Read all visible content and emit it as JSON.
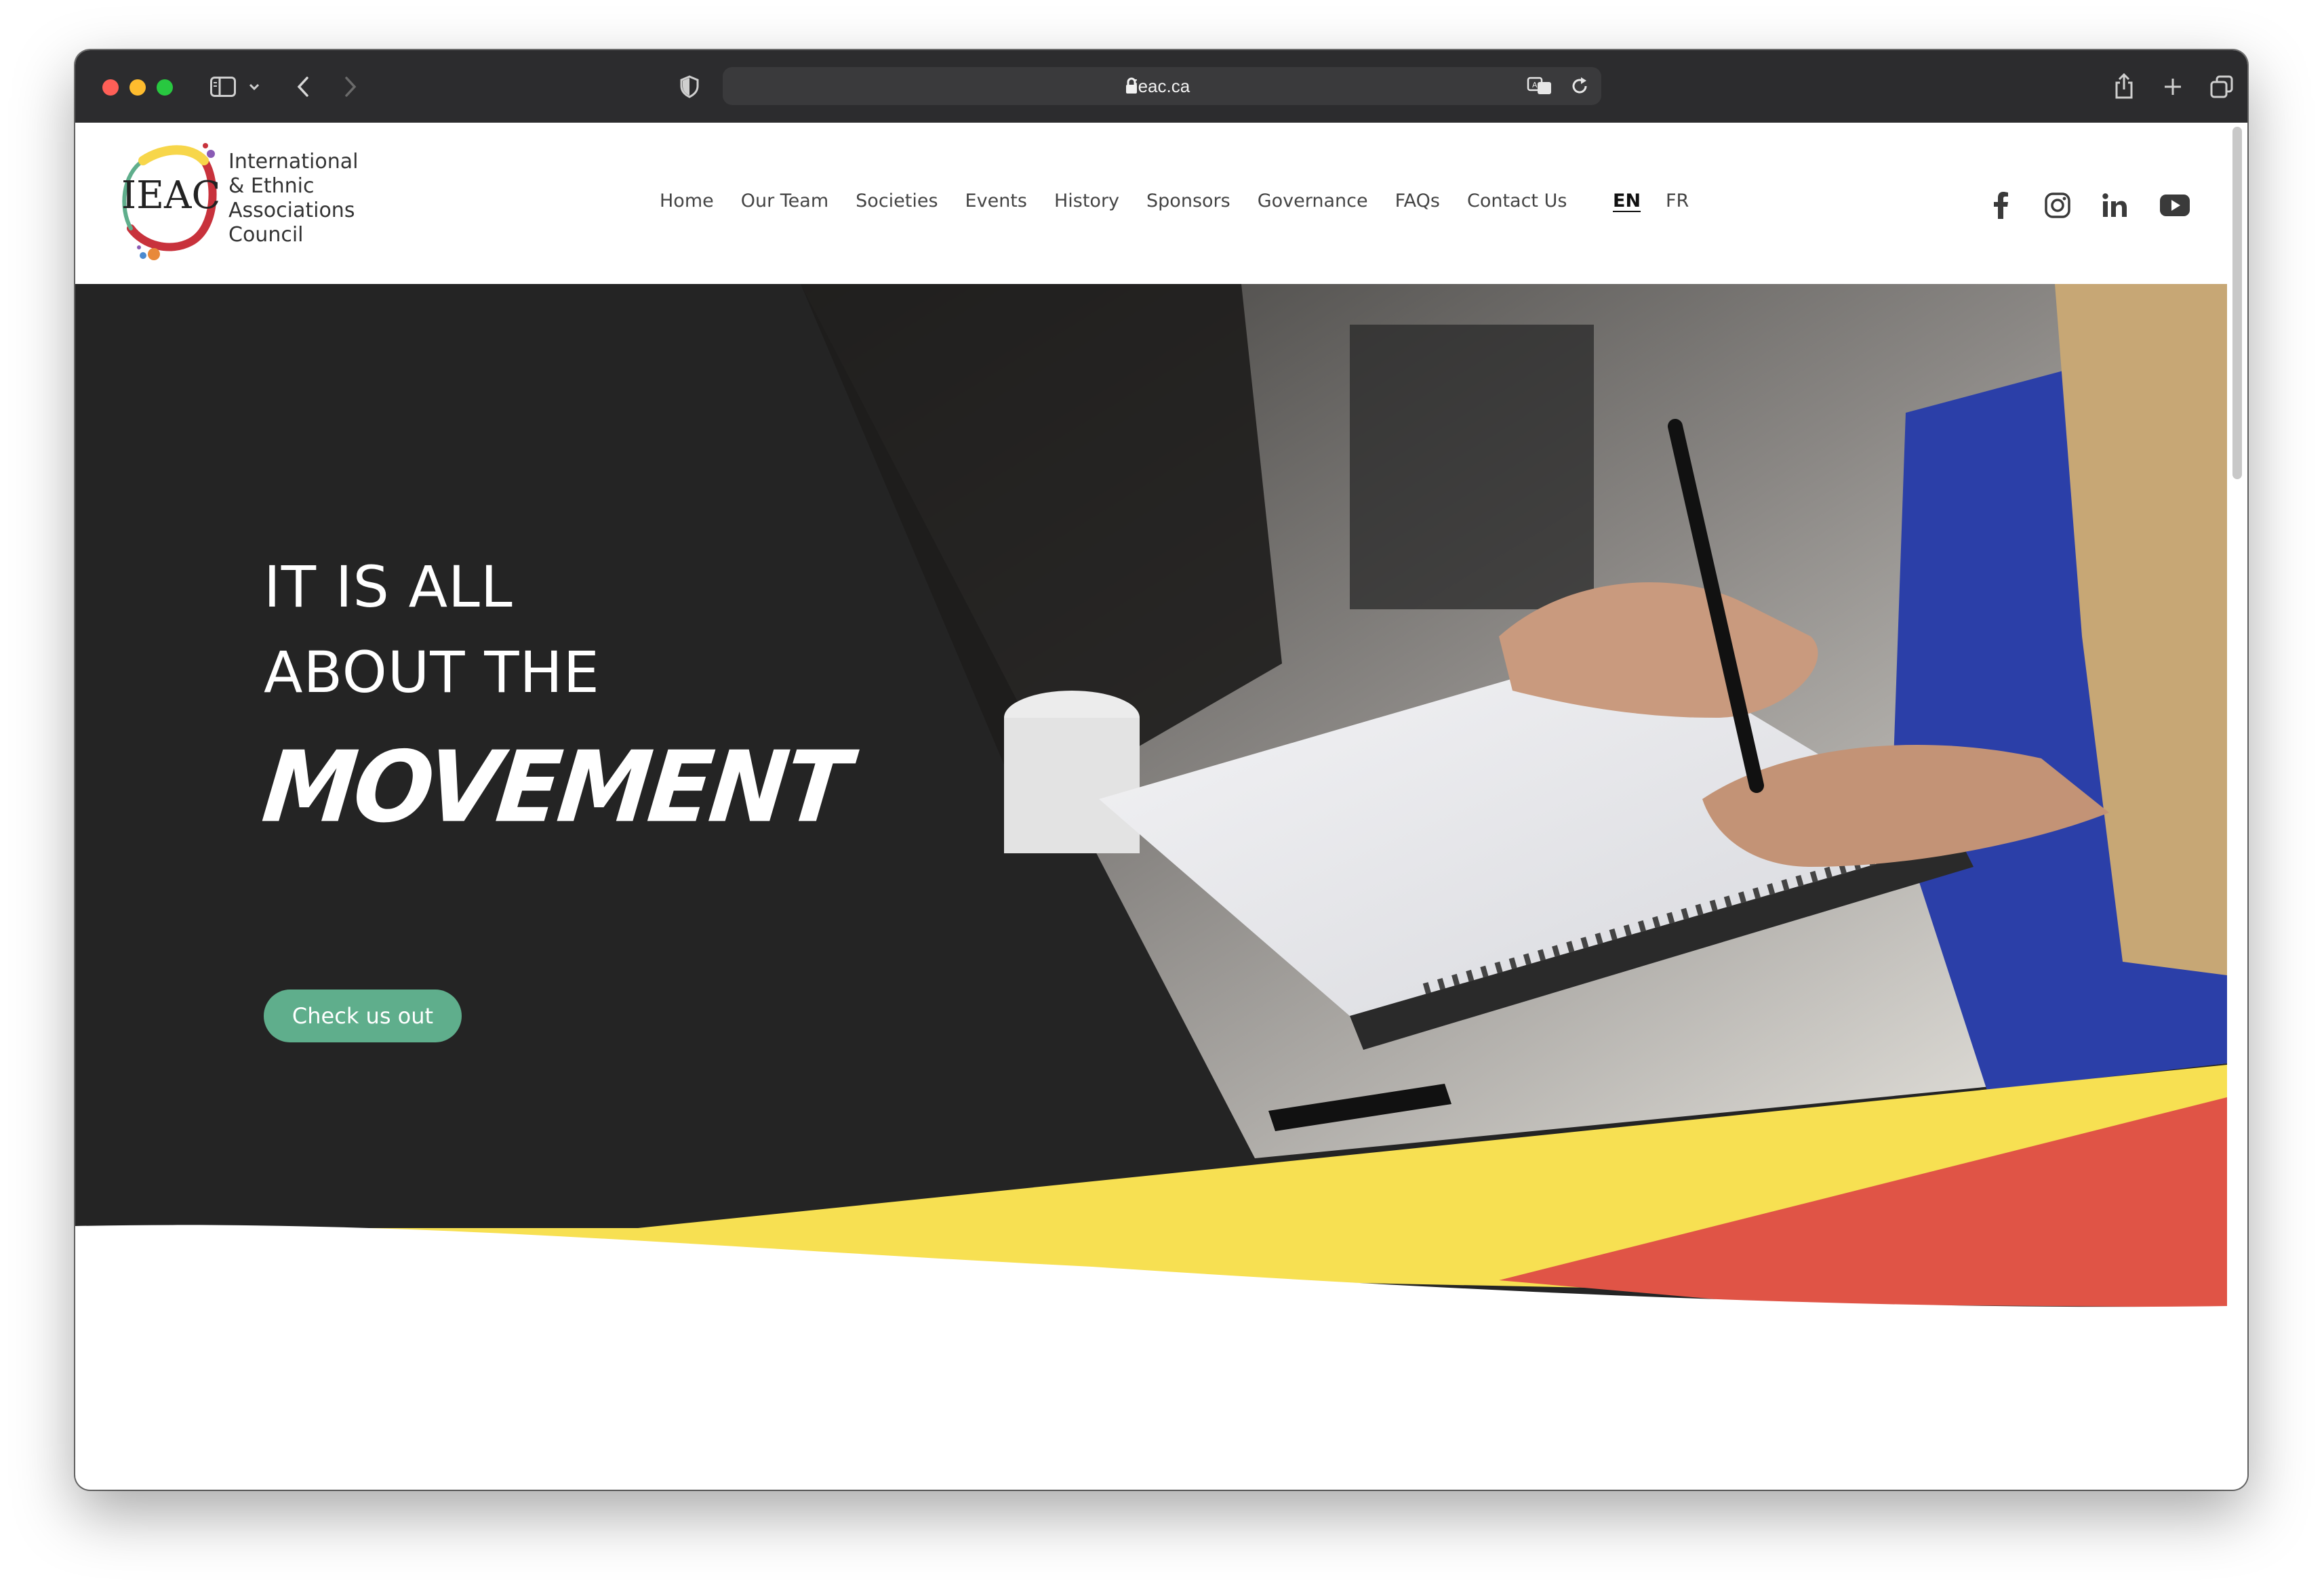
{
  "browser": {
    "url": "ieac.ca",
    "icons": [
      "sidebar-icon",
      "chevron-down-icon",
      "back-icon",
      "forward-icon",
      "shield-icon",
      "lock-icon",
      "translate-icon",
      "reload-icon",
      "share-icon",
      "new-tab-icon",
      "tabs-overview-icon"
    ]
  },
  "site": {
    "logo_mark": "IEAC",
    "logo_lines": [
      "International",
      "& Ethnic",
      "Associations",
      "Council"
    ],
    "nav": [
      "Home",
      "Our Team",
      "Societies",
      "Events",
      "History",
      "Sponsors",
      "Governance",
      "FAQs",
      "Contact Us"
    ],
    "languages": [
      {
        "label": "EN",
        "active": true
      },
      {
        "label": "FR",
        "active": false
      }
    ],
    "social": [
      "facebook-icon",
      "instagram-icon",
      "linkedin-icon",
      "youtube-icon"
    ]
  },
  "hero": {
    "line1": "IT IS ALL",
    "line2": "ABOUT THE",
    "accent": "MOVEMENT",
    "cta": "Check us out",
    "image_description_hidden": ""
  },
  "colors": {
    "hero_dark": "#242424",
    "accent_green": "#5fae8c",
    "stripe_yellow": "#f7e052",
    "stripe_red": "#e05446"
  }
}
